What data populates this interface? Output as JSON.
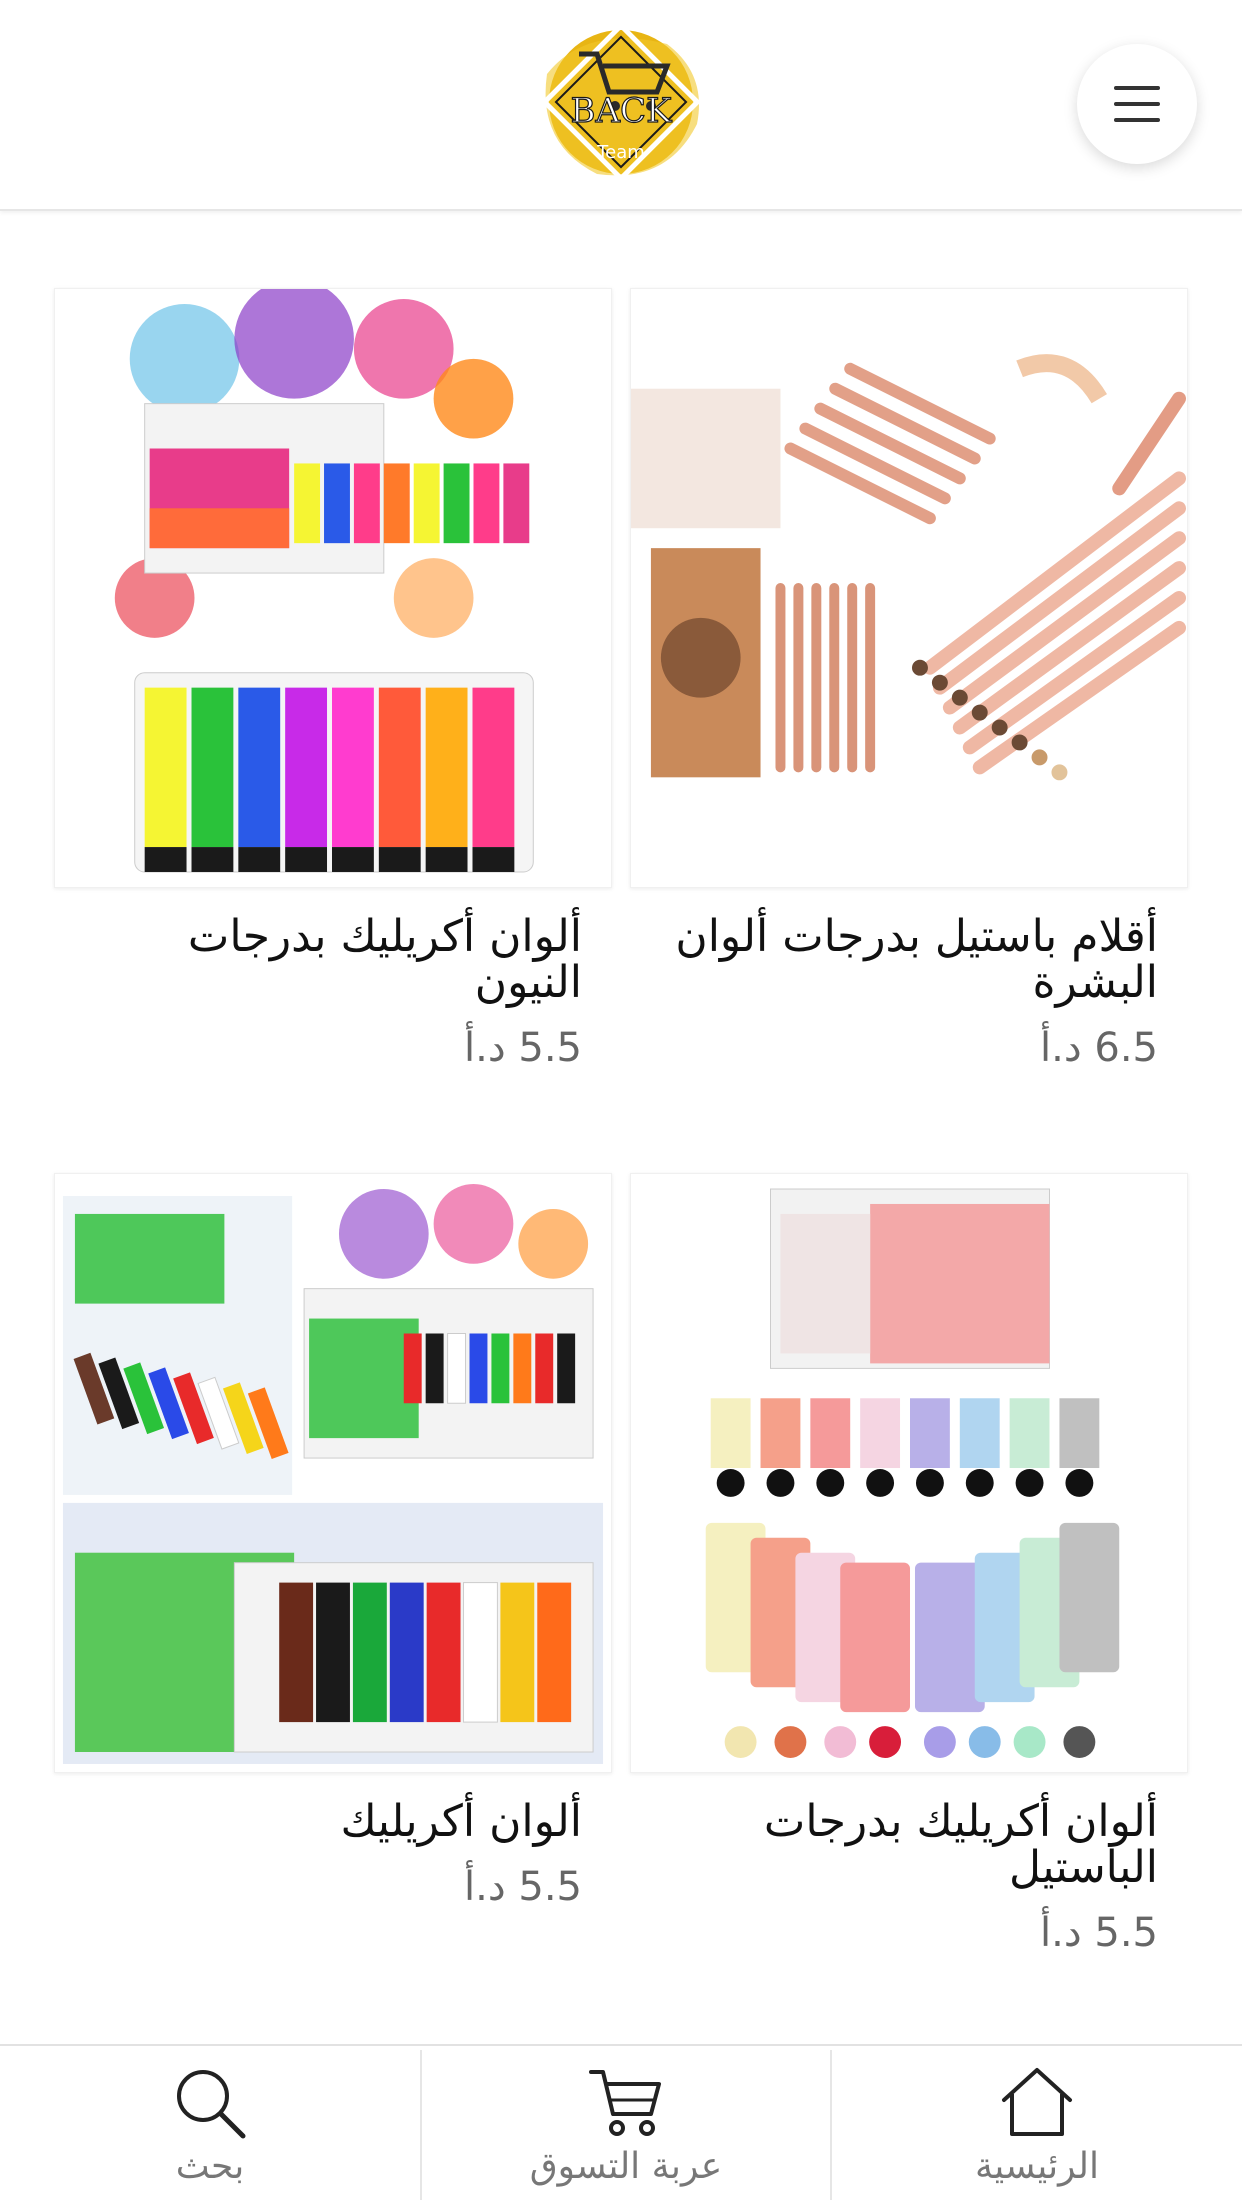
{
  "header": {
    "logo_text_main": "BACK",
    "logo_text_sub": "Team",
    "logo_color": "#e8b514",
    "menu_icon": "hamburger-menu-icon"
  },
  "products": [
    {
      "title": "أقلام باستيل بدرجات ألوان البشرة",
      "price": "6.5 د.أ",
      "image": "pastel-pencils-image"
    },
    {
      "title": "ألوان أكريليك بدرجات النيون",
      "price": "5.5 د.أ",
      "image": "neon-acrylic-paint-image"
    },
    {
      "title": "ألوان أكريليك بدرجات الباستيل",
      "price": "5.5 د.أ",
      "image": "pastel-acrylic-paint-image"
    },
    {
      "title": "ألوان أكريليك",
      "price": "5.5 د.أ",
      "image": "acrylic-paint-image"
    }
  ],
  "bottom_nav": {
    "home": "الرئيسية",
    "cart": "عربة التسوق",
    "search": "بحث"
  }
}
